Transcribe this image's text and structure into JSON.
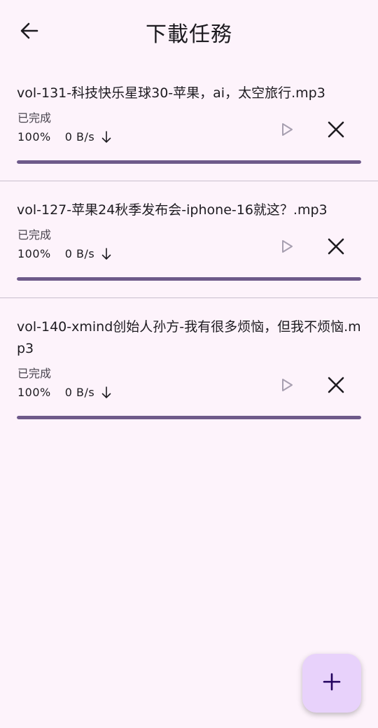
{
  "app_bar": {
    "title": "下載任務",
    "back_icon": "arrow-back-icon"
  },
  "tasks": [
    {
      "name": "vol-131-科技快乐星球30-苹果，ai，太空旅行.mp3",
      "status": "已完成",
      "progress_text": "100%",
      "speed": "0 B/s",
      "progress": 1.0
    },
    {
      "name": "vol-127-苹果24秋季发布会-iphone-16就这？.mp3",
      "status": "已完成",
      "progress_text": "100%",
      "speed": "0 B/s",
      "progress": 1.0
    },
    {
      "name": "vol-140-xmind创始人孙方-我有很多烦恼，但我不烦恼.mp3",
      "status": "已完成",
      "progress_text": "100%",
      "speed": "0 B/s",
      "progress": 1.0
    }
  ],
  "fab": {
    "icon": "add-icon"
  },
  "colors": {
    "background": "#fdf3fb",
    "progress": "#6e5a8a",
    "fab": "#e8d2fb",
    "play_disabled": "#a79fb0"
  }
}
